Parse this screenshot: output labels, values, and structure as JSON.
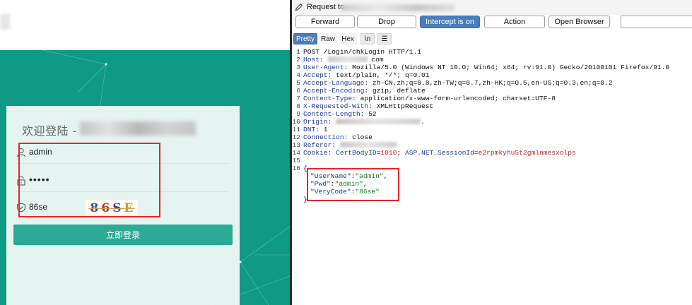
{
  "login": {
    "title": "欢迎登陆 -",
    "username_value": "admin",
    "password_value": "•••••",
    "verify_code_value": "86se",
    "captcha_chars": [
      "8",
      "6",
      "S",
      "E"
    ],
    "captcha_colors": [
      "#3a4aa0",
      "#c0302a",
      "#3a4aa0",
      "#d09a2a"
    ],
    "login_button": "立即登录"
  },
  "burp": {
    "request_label": "Request to",
    "buttons": {
      "forward": "Forward",
      "drop": "Drop",
      "intercept": "Intercept is on",
      "action": "Action",
      "open_browser": "Open Browser"
    },
    "tabs": {
      "pretty": "Pretty",
      "raw": "Raw",
      "hex": "Hex",
      "newline": "\\n",
      "menu": "☰"
    },
    "lines": [
      {
        "n": "1",
        "k": "POST /Login/chkLogin HTTP/1.1",
        "v": ""
      },
      {
        "n": "2",
        "k": "Host:",
        "v": "com"
      },
      {
        "n": "3",
        "k": "User-Agent:",
        "v": " Mozilla/5.0 (Windows NT 10.0; Win64; x64; rv:91.0) Gecko/20100101 Firefox/91.0"
      },
      {
        "n": "4",
        "k": "Accept:",
        "v": " text/plain, */*; q=0.01"
      },
      {
        "n": "5",
        "k": "Accept-Language:",
        "v": " zh-CN,zh;q=0.8,zh-TW;q=0.7,zh-HK;q=0.5,en-US;q=0.3,en;q=0.2"
      },
      {
        "n": "6",
        "k": "Accept-Encoding:",
        "v": " gzip, deflate"
      },
      {
        "n": "7",
        "k": "Content-Type:",
        "v": " application/x-www-form-urlencoded; charset=UTF-8"
      },
      {
        "n": "8",
        "k": "X-Requested-With:",
        "v": " XMLHttpRequest"
      },
      {
        "n": "9",
        "k": "Content-Length:",
        "v": " 52"
      },
      {
        "n": "10",
        "k": "Origin:",
        "v": "."
      },
      {
        "n": "11",
        "k": "DNT:",
        "v": " 1"
      },
      {
        "n": "12",
        "k": "Connection:",
        "v": " close"
      },
      {
        "n": "13",
        "k": "Referer:",
        "v": ""
      },
      {
        "n": "14",
        "k": "Cookie:",
        "v": ""
      },
      {
        "n": "15",
        "k": "",
        "v": ""
      },
      {
        "n": "16",
        "k": "{",
        "v": ""
      },
      {
        "n": "",
        "k": "",
        "v": ""
      },
      {
        "n": "",
        "k": "",
        "v": ""
      },
      {
        "n": "",
        "k": "",
        "v": ""
      },
      {
        "n": "",
        "k": "}",
        "v": ""
      }
    ],
    "cookie": {
      "name1": "CertBodyID",
      "val1": "1010",
      "name2": "ASP.NET_SessionId",
      "val2": "e2rpmkyhu5t2gmlnmesxolps"
    },
    "json_body": [
      {
        "key": "\"UserName\"",
        "val": "\"admin\"",
        "tail": ","
      },
      {
        "key": "\"Pwd\"",
        "val": "\"admin\"",
        "tail": ","
      },
      {
        "key": "\"VeryCode\"",
        "val": "\"86se\"",
        "tail": ""
      }
    ]
  }
}
